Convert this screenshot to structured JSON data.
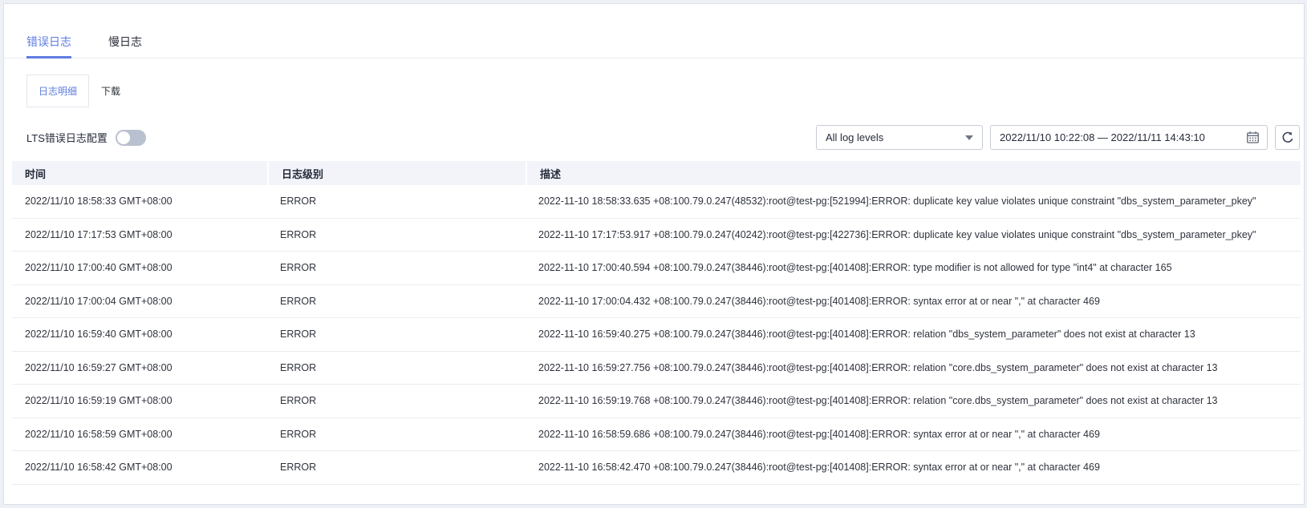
{
  "tabs": [
    {
      "label": "错误日志"
    },
    {
      "label": "慢日志"
    }
  ],
  "sub_tabs": [
    {
      "label": "日志明细"
    },
    {
      "label": "下载"
    }
  ],
  "controls": {
    "lts_label": "LTS错误日志配置",
    "lts_toggle_state": "off",
    "log_level_selected": "All log levels",
    "date_range": "2022/11/10 10:22:08 — 2022/11/11 14:43:10"
  },
  "colors": {
    "accent_blue": "#5e7ce0",
    "header_bg": "#f2f4fa",
    "page_bg": "#edf0f5",
    "toggle_off": "#b9c0cf"
  },
  "table": {
    "columns": [
      "时间",
      "日志级别",
      "描述"
    ],
    "rows": [
      {
        "time": "2022/11/10 18:58:33 GMT+08:00",
        "level": "ERROR",
        "desc": "2022-11-10 18:58:33.635 +08:100.79.0.247(48532):root@test-pg:[521994]:ERROR: duplicate key value violates unique constraint \"dbs_system_parameter_pkey\""
      },
      {
        "time": "2022/11/10 17:17:53 GMT+08:00",
        "level": "ERROR",
        "desc": "2022-11-10 17:17:53.917 +08:100.79.0.247(40242):root@test-pg:[422736]:ERROR: duplicate key value violates unique constraint \"dbs_system_parameter_pkey\""
      },
      {
        "time": "2022/11/10 17:00:40 GMT+08:00",
        "level": "ERROR",
        "desc": "2022-11-10 17:00:40.594 +08:100.79.0.247(38446):root@test-pg:[401408]:ERROR: type modifier is not allowed for type \"int4\" at character 165"
      },
      {
        "time": "2022/11/10 17:00:04 GMT+08:00",
        "level": "ERROR",
        "desc": "2022-11-10 17:00:04.432 +08:100.79.0.247(38446):root@test-pg:[401408]:ERROR: syntax error at or near \",\" at character 469"
      },
      {
        "time": "2022/11/10 16:59:40 GMT+08:00",
        "level": "ERROR",
        "desc": "2022-11-10 16:59:40.275 +08:100.79.0.247(38446):root@test-pg:[401408]:ERROR: relation \"dbs_system_parameter\" does not exist at character 13"
      },
      {
        "time": "2022/11/10 16:59:27 GMT+08:00",
        "level": "ERROR",
        "desc": "2022-11-10 16:59:27.756 +08:100.79.0.247(38446):root@test-pg:[401408]:ERROR: relation \"core.dbs_system_parameter\" does not exist at character 13"
      },
      {
        "time": "2022/11/10 16:59:19 GMT+08:00",
        "level": "ERROR",
        "desc": "2022-11-10 16:59:19.768 +08:100.79.0.247(38446):root@test-pg:[401408]:ERROR: relation \"core.dbs_system_parameter\" does not exist at character 13"
      },
      {
        "time": "2022/11/10 16:58:59 GMT+08:00",
        "level": "ERROR",
        "desc": "2022-11-10 16:58:59.686 +08:100.79.0.247(38446):root@test-pg:[401408]:ERROR: syntax error at or near \",\" at character 469"
      },
      {
        "time": "2022/11/10 16:58:42 GMT+08:00",
        "level": "ERROR",
        "desc": "2022-11-10 16:58:42.470 +08:100.79.0.247(38446):root@test-pg:[401408]:ERROR: syntax error at or near \",\" at character 469"
      }
    ]
  }
}
